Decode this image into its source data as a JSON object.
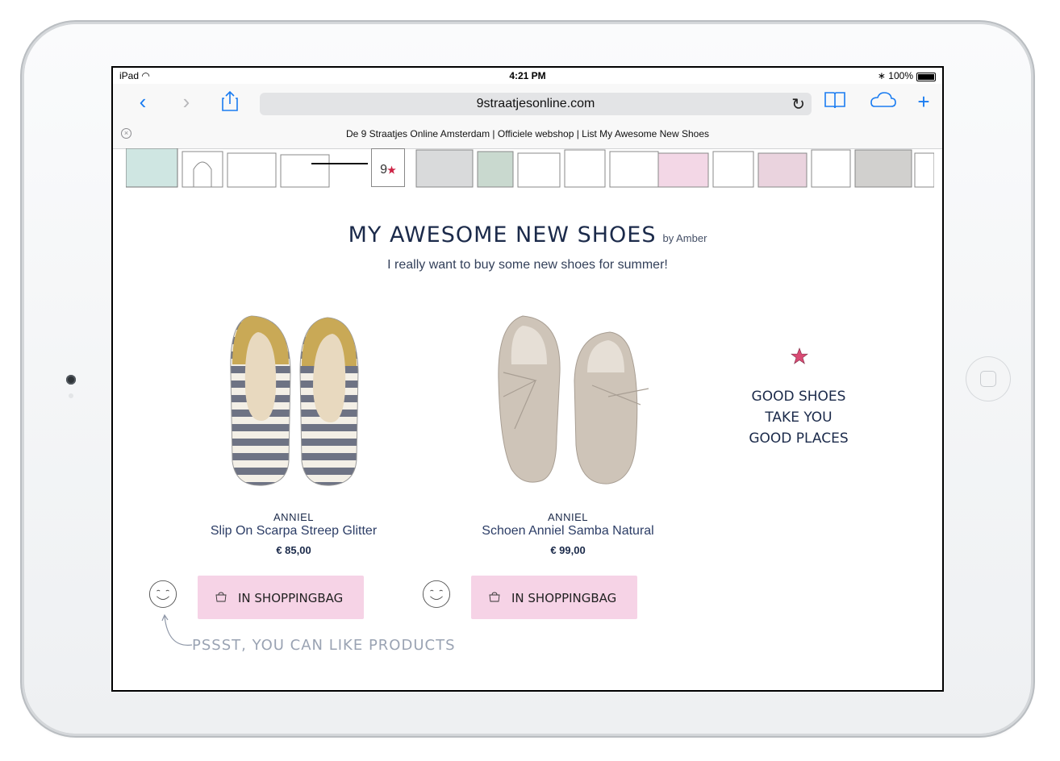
{
  "status_bar": {
    "device": "iPad",
    "time": "4:21 PM",
    "battery": "100%"
  },
  "browser": {
    "url": "9straatjesonline.com",
    "tab_title": "De 9 Straatjes Online Amsterdam | Officiele webshop | List My Awesome New Shoes"
  },
  "page": {
    "title": "MY AWESOME NEW SHOES",
    "by": "by Amber",
    "subtitle": "I really want to buy some new shoes for summer!"
  },
  "products": [
    {
      "brand": "ANNIEL",
      "name": "Slip On Scarpa Streep Glitter",
      "price": "€ 85,00",
      "button": "IN SHOPPINGBAG"
    },
    {
      "brand": "ANNIEL",
      "name": "Schoen Anniel Samba Natural",
      "price": "€ 99,00",
      "button": "IN SHOPPINGBAG"
    }
  ],
  "quote": {
    "line1": "GOOD SHOES",
    "line2": "TAKE YOU",
    "line3": "GOOD PLACES"
  },
  "hint": "PSSST, YOU CAN LIKE PRODUCTS",
  "colors": {
    "accent": "#1a7cf1",
    "button_bg": "#f6d3e6",
    "text_dark": "#1b2a4a",
    "star": "#d94a73"
  }
}
